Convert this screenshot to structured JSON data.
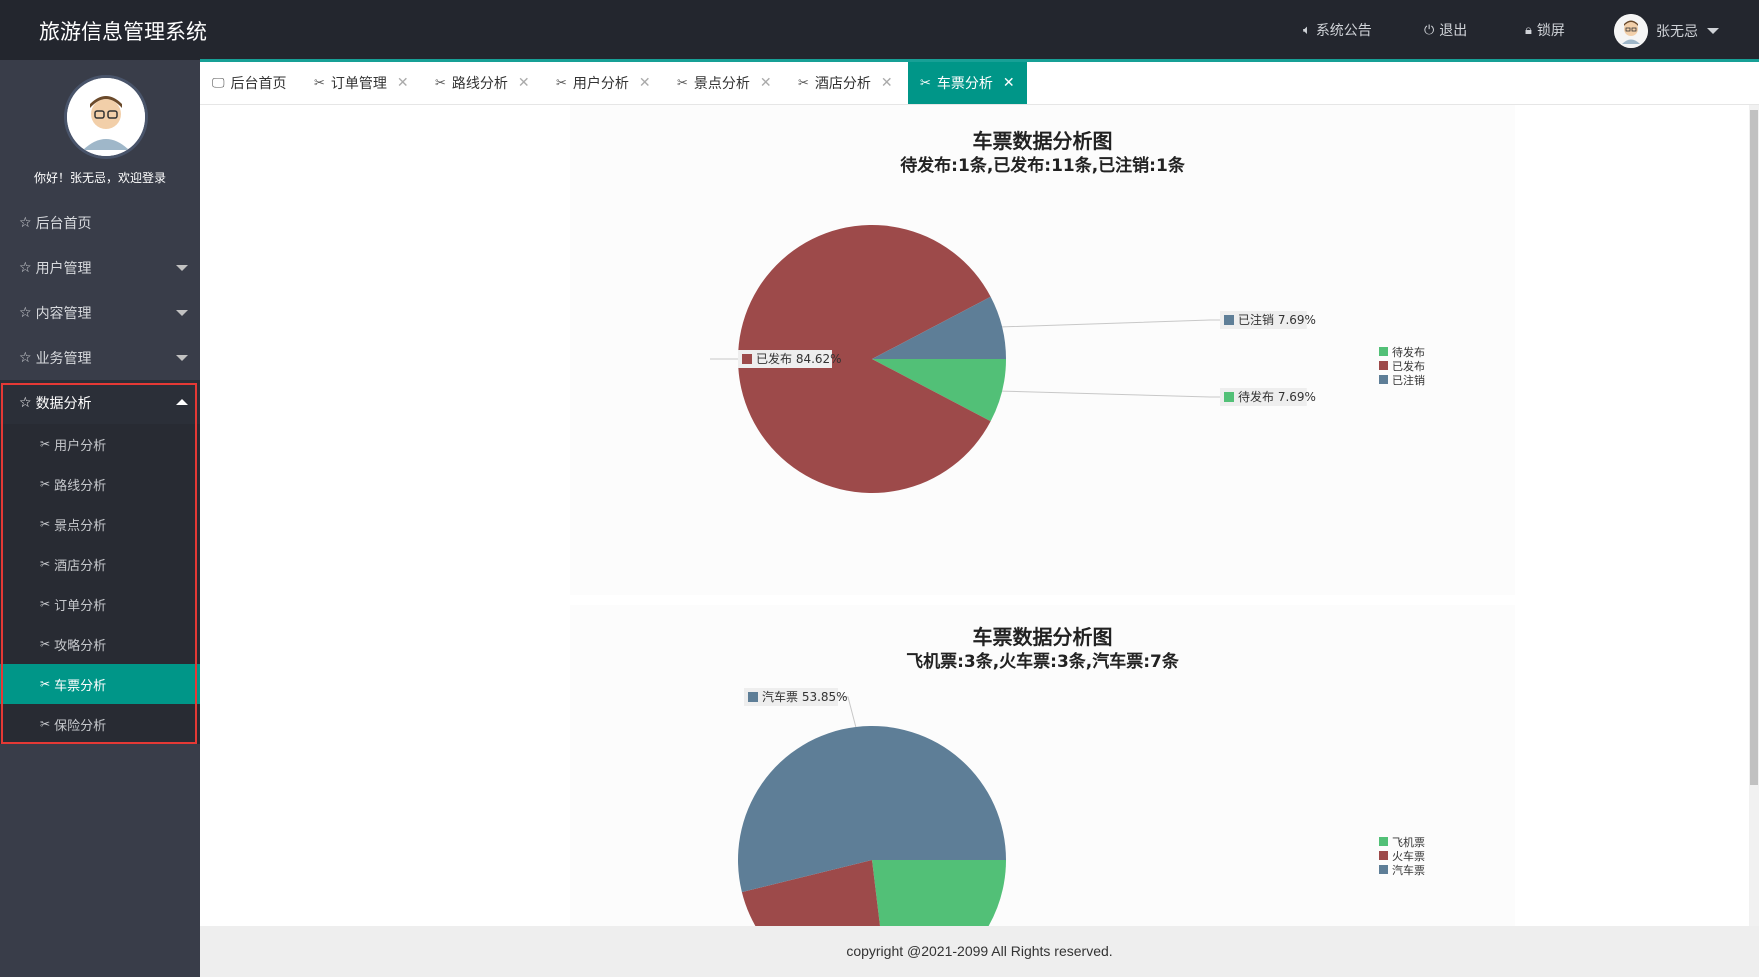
{
  "app": {
    "title": "旅游信息管理系统"
  },
  "topbar": {
    "notice_label": "系统公告",
    "logout_label": "退出",
    "lock_label": "锁屏",
    "user_name": "张无忌"
  },
  "sidebar": {
    "welcome": "你好！张无忌，欢迎登录",
    "menu": [
      {
        "label": "后台首页"
      },
      {
        "label": "用户管理"
      },
      {
        "label": "内容管理"
      },
      {
        "label": "业务管理"
      },
      {
        "label": "数据分析"
      }
    ],
    "submenu": [
      {
        "label": "用户分析"
      },
      {
        "label": "路线分析"
      },
      {
        "label": "景点分析"
      },
      {
        "label": "酒店分析"
      },
      {
        "label": "订单分析"
      },
      {
        "label": "攻略分析"
      },
      {
        "label": "车票分析"
      },
      {
        "label": "保险分析"
      }
    ]
  },
  "tabs": [
    {
      "label": "后台首页"
    },
    {
      "label": "订单管理"
    },
    {
      "label": "路线分析"
    },
    {
      "label": "用户分析"
    },
    {
      "label": "景点分析"
    },
    {
      "label": "酒店分析"
    },
    {
      "label": "车票分析"
    }
  ],
  "footer": {
    "text": "copyright @2021-2099 All Rights reserved."
  },
  "colors": {
    "sidebar_bg": "#393d49",
    "accent": "#009688",
    "header_bg": "#23262e",
    "highlight_border": "#e53935"
  },
  "chart_data": [
    {
      "type": "pie",
      "title": "车票数据分析图",
      "subtitle": "待发布:1条,已发布:11条,已注销:1条",
      "legend_position": "right",
      "slices": [
        {
          "name": "待发布",
          "value": 1,
          "percent": "7.69%",
          "color": "#52c077"
        },
        {
          "name": "已发布",
          "value": 11,
          "percent": "84.62%",
          "color": "#9d4a4a"
        },
        {
          "name": "已注销",
          "value": 1,
          "percent": "7.69%",
          "color": "#5e7e97"
        }
      ]
    },
    {
      "type": "pie",
      "title": "车票数据分析图",
      "subtitle": "飞机票:3条,火车票:3条,汽车票:7条",
      "legend_position": "right",
      "slices": [
        {
          "name": "飞机票",
          "value": 3,
          "percent": "23.08%",
          "color": "#52c077"
        },
        {
          "name": "火车票",
          "value": 3,
          "percent": "23.08%",
          "color": "#9d4a4a"
        },
        {
          "name": "汽车票",
          "value": 7,
          "percent": "53.85%",
          "color": "#5e7e97"
        }
      ]
    }
  ]
}
